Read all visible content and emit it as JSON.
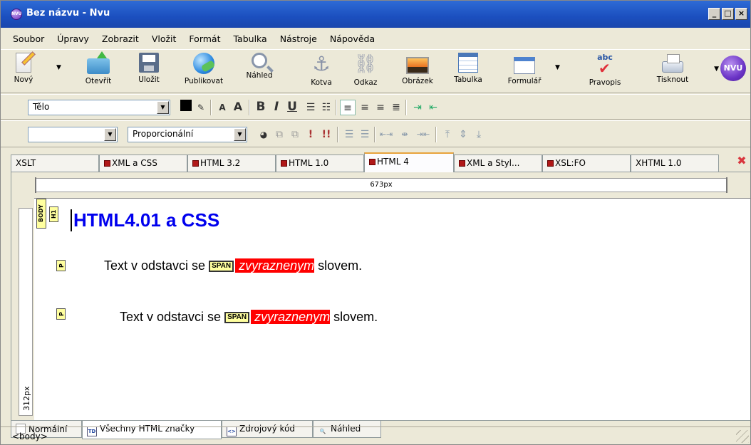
{
  "window": {
    "title": "Bez názvu - Nvu",
    "app_icon": "nvu-icon",
    "controls": [
      "_",
      "□",
      "×"
    ]
  },
  "menu": [
    "Soubor",
    "Úpravy",
    "Zobrazit",
    "Vložit",
    "Formát",
    "Tabulka",
    "Nástroje",
    "Nápověda"
  ],
  "toolbar": {
    "new": "Nový",
    "open": "Otevřít",
    "save": "Uložit",
    "publish": "Publikovat",
    "preview": "Náhled",
    "anchor": "Kotva",
    "link": "Odkaz",
    "image": "Obrázek",
    "table": "Tabulka",
    "form": "Formulář",
    "spell": "Pravopis",
    "print": "Tisknout",
    "logo": "NVU"
  },
  "format": {
    "paragraph_style": "Tělo",
    "class_value": "",
    "font": "Proporcionální"
  },
  "ruler": {
    "top_label": "673px",
    "side_label": "312px"
  },
  "doc_tabs": [
    {
      "label": "XSLT",
      "flag": false
    },
    {
      "label": "XML a CSS",
      "flag": true
    },
    {
      "label": "HTML 3.2",
      "flag": true
    },
    {
      "label": "HTML 1.0",
      "flag": true
    },
    {
      "label": "HTML 4",
      "flag": true,
      "active": true
    },
    {
      "label": "XML a Styl...",
      "flag": true
    },
    {
      "label": "XSL:FO",
      "flag": true
    },
    {
      "label": "XHTML 1.0",
      "flag": false
    }
  ],
  "content": {
    "tag_body": "BODY",
    "tag_h1": "H1",
    "tag_p": "P",
    "tag_span": "SPAN",
    "heading": "HTML4.01 a CSS",
    "p_before": "Text v odstavci se ",
    "p_emph": "zvyraznenym",
    "p_after": " slovem."
  },
  "mode_tabs": [
    "Normální",
    "Všechny HTML značky",
    "Zdrojový kód",
    "Náhled"
  ],
  "mode_icons": {
    "all_tags": "TD",
    "source": "<>"
  },
  "status": "<body>"
}
